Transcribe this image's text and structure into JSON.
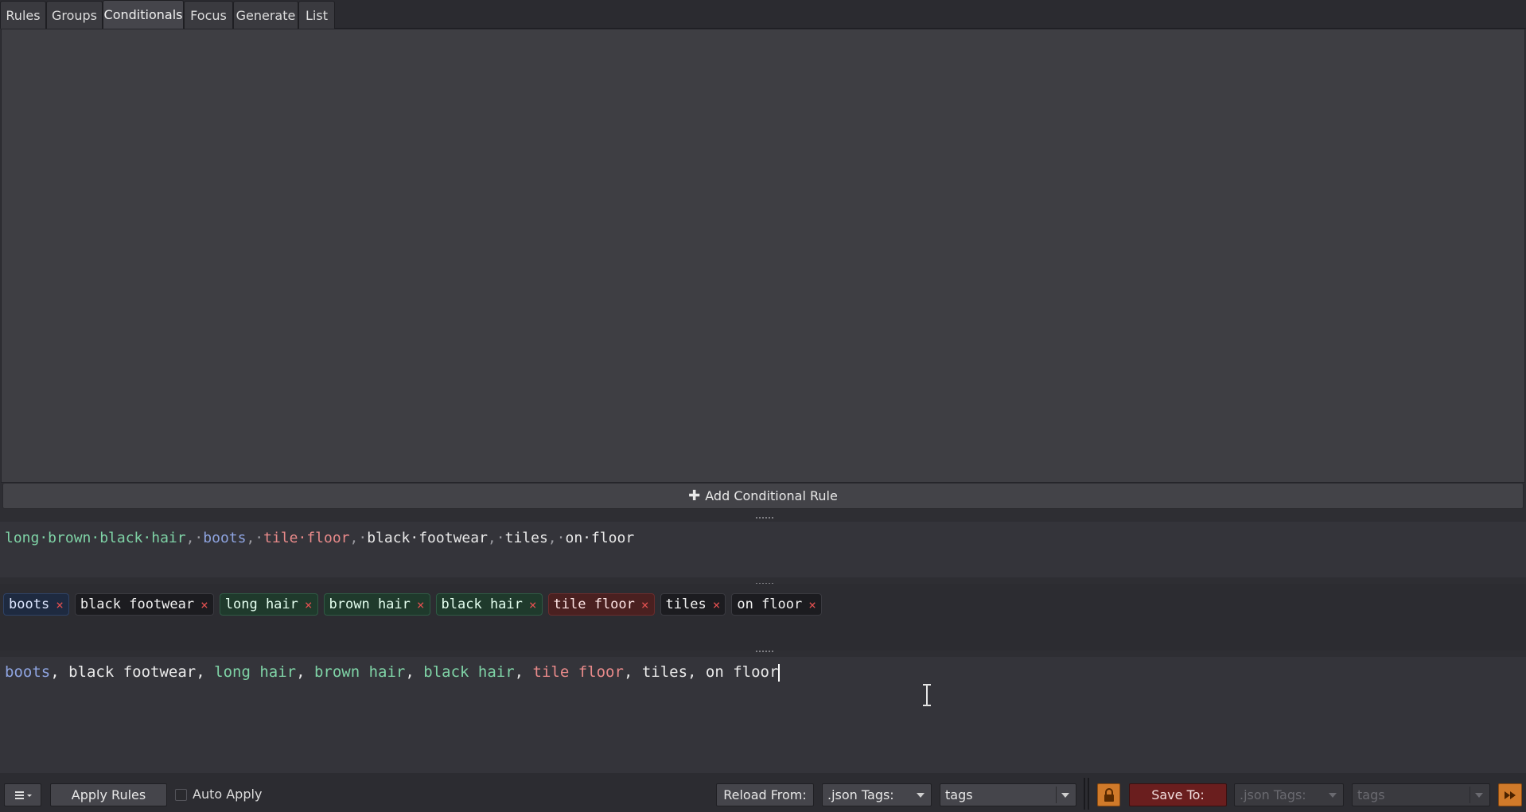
{
  "tabs": [
    {
      "label": "Rules"
    },
    {
      "label": "Groups"
    },
    {
      "label": "Conditionals",
      "active": true
    },
    {
      "label": "Focus"
    },
    {
      "label": "Generate"
    },
    {
      "label": "List"
    }
  ],
  "add_button_label": "Add Conditional Rule",
  "source_editor": {
    "tokens": [
      {
        "text": "long·brown·black·hair",
        "color": "green"
      },
      {
        "text": ",·",
        "color": "dim"
      },
      {
        "text": "boots",
        "color": "blue"
      },
      {
        "text": ",·",
        "color": "dim"
      },
      {
        "text": "tile·floor",
        "color": "red"
      },
      {
        "text": ",·",
        "color": "dim"
      },
      {
        "text": "black·footwear",
        "color": "white"
      },
      {
        "text": ",·",
        "color": "dim"
      },
      {
        "text": "tiles",
        "color": "white"
      },
      {
        "text": ",·",
        "color": "dim"
      },
      {
        "text": "on·floor",
        "color": "white"
      }
    ]
  },
  "tags": [
    {
      "label": "boots",
      "style": "blue"
    },
    {
      "label": "black footwear",
      "style": "dark"
    },
    {
      "label": "long hair",
      "style": "green"
    },
    {
      "label": "brown hair",
      "style": "green"
    },
    {
      "label": "black hair",
      "style": "green"
    },
    {
      "label": "tile floor",
      "style": "red"
    },
    {
      "label": "tiles",
      "style": "dark"
    },
    {
      "label": "on floor",
      "style": "dark"
    }
  ],
  "tag_remove_glyph": "×",
  "output_editor": {
    "tokens": [
      {
        "text": "boots",
        "color": "blue"
      },
      {
        "text": ", ",
        "color": "white"
      },
      {
        "text": "black footwear",
        "color": "white"
      },
      {
        "text": ", ",
        "color": "white"
      },
      {
        "text": "long hair",
        "color": "green"
      },
      {
        "text": ", ",
        "color": "white"
      },
      {
        "text": "brown hair",
        "color": "green"
      },
      {
        "text": ", ",
        "color": "white"
      },
      {
        "text": "black hair",
        "color": "green"
      },
      {
        "text": ", ",
        "color": "white"
      },
      {
        "text": "tile floor",
        "color": "red"
      },
      {
        "text": ", ",
        "color": "white"
      },
      {
        "text": "tiles",
        "color": "white"
      },
      {
        "text": ", ",
        "color": "white"
      },
      {
        "text": "on floor",
        "color": "white"
      }
    ]
  },
  "toolbar": {
    "menu_icon": "hamburger-icon",
    "apply_rules_label": "Apply Rules",
    "auto_apply_label": "Auto Apply",
    "auto_apply_checked": false,
    "reload_from_label": "Reload From:",
    "reload_format_value": ".json Tags:",
    "reload_key_value": "tags",
    "lock_icon": "lock-icon",
    "save_to_label": "Save To:",
    "save_format_value": ".json Tags:",
    "save_key_value": "tags",
    "fast_forward_icon": "fast-forward-icon"
  },
  "colors": {
    "green": "#7fd3a6",
    "blue": "#8ea4e0",
    "red": "#e88a8a",
    "accent_orange": "#d07a2a",
    "save_red": "#6a1e1e"
  }
}
